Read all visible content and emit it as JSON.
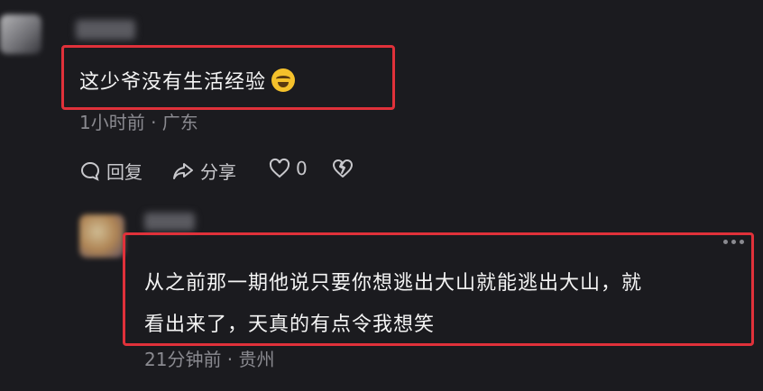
{
  "comment1": {
    "text": "这少爷没有生活经验",
    "emoji_icon": "laughing-crying-emoji",
    "meta": "1小时前 · 广东",
    "actions": {
      "reply_label": "回复",
      "share_label": "分享",
      "like_count": "0"
    }
  },
  "comment2": {
    "line1": "从之前那一期他说只要你想逃出大山就能逃出大山，就",
    "line2": "看出来了，天真的有点令我想笑",
    "meta": "21分钟前 · 贵州"
  },
  "colors": {
    "background": "#1b1b1f",
    "highlight": "#e0313a",
    "meta": "#8a8a90"
  }
}
